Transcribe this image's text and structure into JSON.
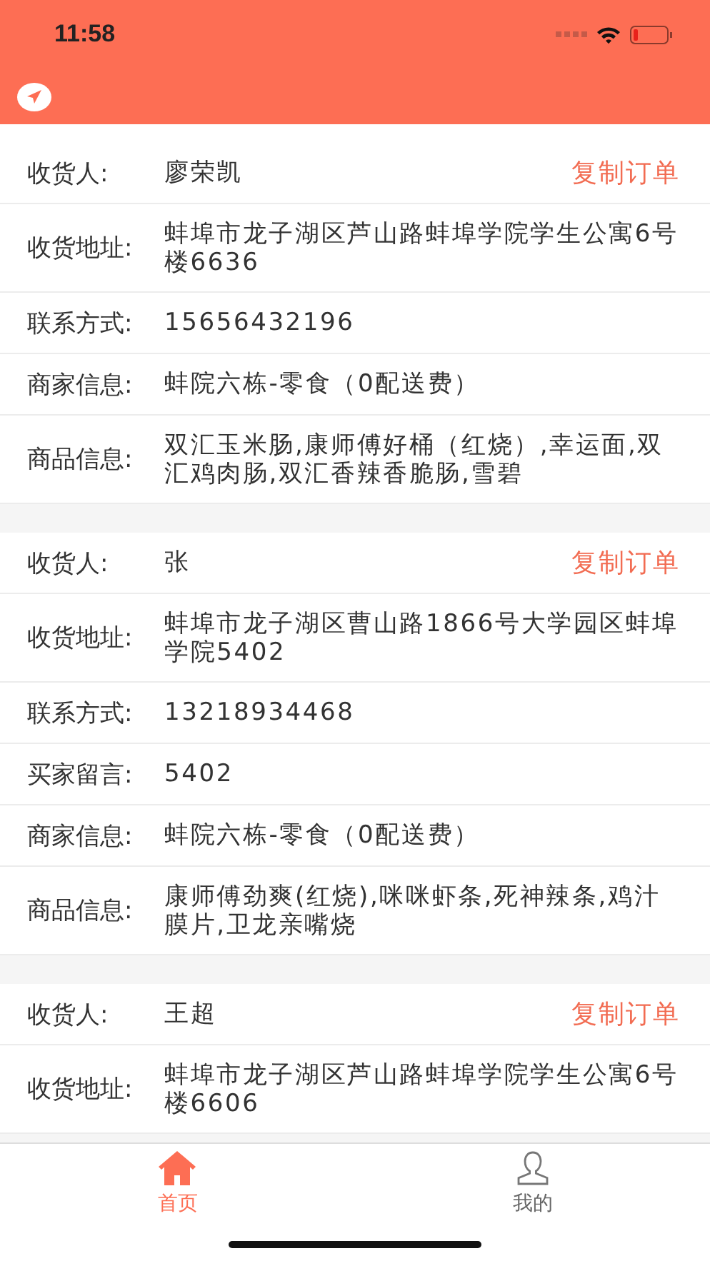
{
  "status_bar": {
    "time": "11:58"
  },
  "orders": [
    {
      "copy_button": "复制订单",
      "rows": [
        {
          "label": "收货人:",
          "value": "廖荣凯"
        },
        {
          "label": "收货地址:",
          "value": "蚌埠市龙子湖区芦山路蚌埠学院学生公寓6号楼6636"
        },
        {
          "label": "联系方式:",
          "value": "15656432196"
        },
        {
          "label": "商家信息:",
          "value": "蚌院六栋-零食（0配送费）"
        },
        {
          "label": "商品信息:",
          "value": "双汇玉米肠,康师傅好桶（红烧）,幸运面,双汇鸡肉肠,双汇香辣香脆肠,雪碧"
        }
      ]
    },
    {
      "copy_button": "复制订单",
      "rows": [
        {
          "label": "收货人:",
          "value": "张"
        },
        {
          "label": "收货地址:",
          "value": "蚌埠市龙子湖区曹山路1866号大学园区蚌埠学院5402"
        },
        {
          "label": "联系方式:",
          "value": "13218934468"
        },
        {
          "label": "买家留言:",
          "value": "5402"
        },
        {
          "label": "商家信息:",
          "value": "蚌院六栋-零食（0配送费）"
        },
        {
          "label": "商品信息:",
          "value": "康师傅劲爽(红烧),咪咪虾条,死神辣条,鸡汁膜片,卫龙亲嘴烧"
        }
      ]
    },
    {
      "copy_button": "复制订单",
      "rows": [
        {
          "label": "收货人:",
          "value": "王超"
        },
        {
          "label": "收货地址:",
          "value": "蚌埠市龙子湖区芦山路蚌埠学院学生公寓6号楼6606"
        }
      ]
    }
  ],
  "tabs": [
    {
      "label": "首页",
      "selected": true
    },
    {
      "label": "我的",
      "selected": false
    }
  ]
}
